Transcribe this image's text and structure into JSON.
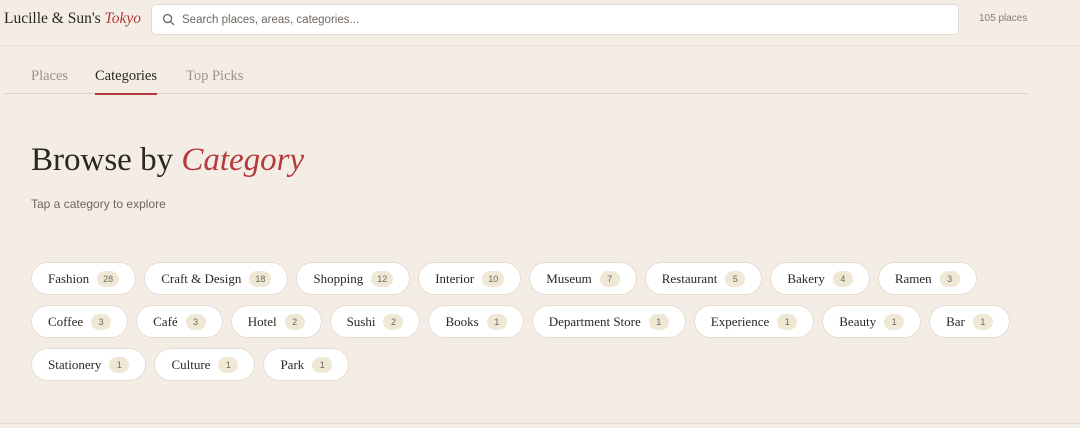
{
  "header": {
    "brand_main": "Lucille & Sun's",
    "brand_accent": "Tokyo",
    "search_placeholder": "Search places, areas, categories...",
    "place_count": "105 places"
  },
  "tabs": [
    {
      "label": "Places",
      "active": false
    },
    {
      "label": "Categories",
      "active": true
    },
    {
      "label": "Top Picks",
      "active": false
    }
  ],
  "main": {
    "heading_main": "Browse by",
    "heading_accent": "Category",
    "subtitle": "Tap a category to explore"
  },
  "categories": [
    {
      "label": "Fashion",
      "count": "28"
    },
    {
      "label": "Craft & Design",
      "count": "18"
    },
    {
      "label": "Shopping",
      "count": "12"
    },
    {
      "label": "Interior",
      "count": "10"
    },
    {
      "label": "Museum",
      "count": "7"
    },
    {
      "label": "Restaurant",
      "count": "5"
    },
    {
      "label": "Bakery",
      "count": "4"
    },
    {
      "label": "Ramen",
      "count": "3"
    },
    {
      "label": "Coffee",
      "count": "3"
    },
    {
      "label": "Café",
      "count": "3"
    },
    {
      "label": "Hotel",
      "count": "2"
    },
    {
      "label": "Sushi",
      "count": "2"
    },
    {
      "label": "Books",
      "count": "1"
    },
    {
      "label": "Department Store",
      "count": "1"
    },
    {
      "label": "Experience",
      "count": "1"
    },
    {
      "label": "Beauty",
      "count": "1"
    },
    {
      "label": "Bar",
      "count": "1"
    },
    {
      "label": "Stationery",
      "count": "1"
    },
    {
      "label": "Culture",
      "count": "1"
    },
    {
      "label": "Park",
      "count": "1"
    }
  ],
  "icons": {
    "search": "search-icon"
  },
  "colors": {
    "background": "#f3ede6",
    "accent": "#b53a3a",
    "chip_bg": "#ffffff",
    "badge_bg": "#efe8d4"
  }
}
